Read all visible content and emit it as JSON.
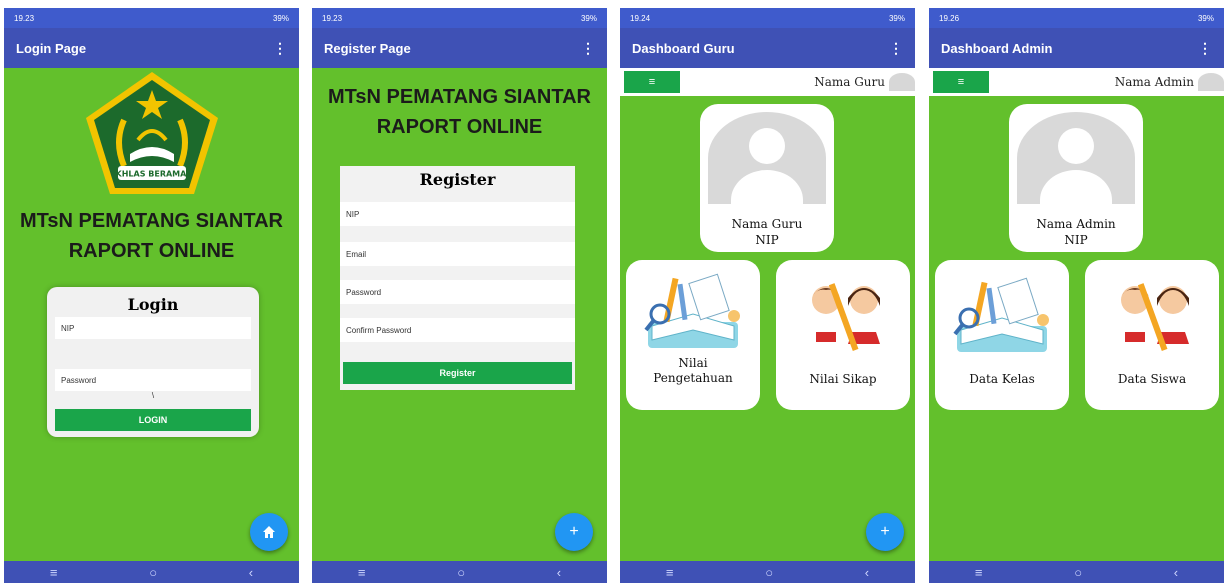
{
  "phones": [
    {
      "status": {
        "time": "19.23",
        "battery": "39%"
      },
      "appbar_title": "Login Page",
      "logo_text": "IKHLAS BERAMAL",
      "headline_1": "MTsN PEMATANG SIANTAR",
      "headline_2": "RAPORT ONLINE",
      "card": {
        "title": "Login",
        "nip_placeholder": "NIP",
        "password_placeholder": "Password",
        "backslash": "\\",
        "button": "LOGIN"
      },
      "fab_icon": "home-icon"
    },
    {
      "status": {
        "time": "19.23",
        "battery": "39%"
      },
      "appbar_title": "Register Page",
      "headline_1": "MTsN PEMATANG SIANTAR",
      "headline_2": "RAPORT ONLINE",
      "card": {
        "title": "Register",
        "nip_placeholder": "NIP",
        "email_placeholder": "Email",
        "password_placeholder": "Password",
        "confirm_placeholder": "Confirm Password",
        "button": "Register"
      },
      "fab_label": "+"
    },
    {
      "status": {
        "time": "19.24",
        "battery": "39%"
      },
      "appbar_title": "Dashboard Guru",
      "user_name": "Nama Guru",
      "profile_name": "Nama Guru",
      "profile_id": "NIP",
      "tiles": [
        {
          "line1": "Nilai",
          "line2": "Pengetahuan"
        },
        {
          "line1": "Nilai Sikap"
        }
      ],
      "fab_label": "+"
    },
    {
      "status": {
        "time": "19.26",
        "battery": "39%"
      },
      "appbar_title": "Dashboard Admin",
      "user_name": "Nama Admin",
      "profile_name": "Nama Admin",
      "profile_id": "NIP",
      "tiles": [
        {
          "line1": "Data Kelas"
        },
        {
          "line1": "Data Siswa"
        }
      ]
    }
  ],
  "colors": {
    "background": "#63c02c",
    "appbar": "#3f51b5",
    "button": "#1aa54a",
    "fab": "#2196f3"
  }
}
